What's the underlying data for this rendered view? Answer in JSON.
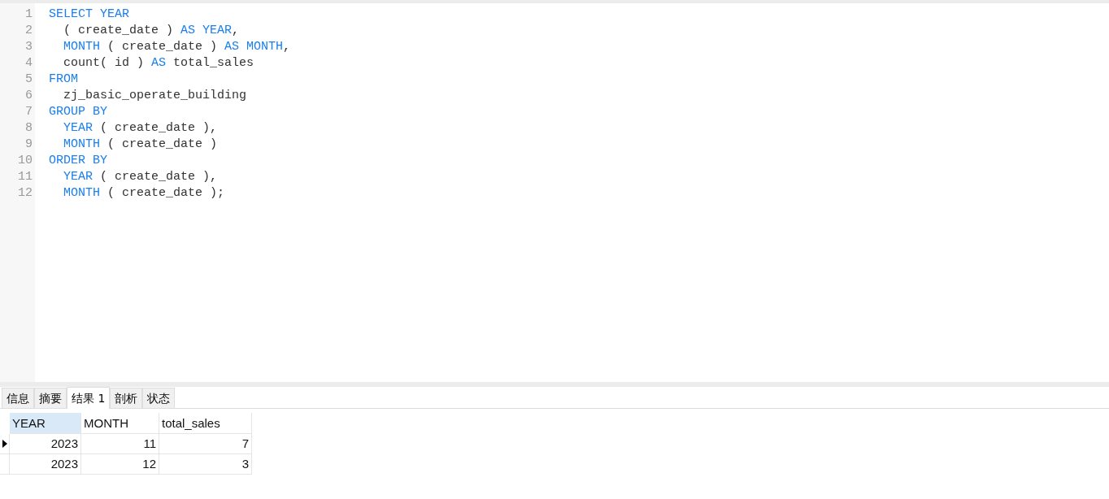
{
  "editor": {
    "lines": [
      {
        "number": "1",
        "tokens": [
          {
            "text": "SELECT YEAR",
            "kind": "keyword"
          }
        ]
      },
      {
        "number": "2",
        "tokens": [
          {
            "text": "  ( create_date ) ",
            "kind": "plain"
          },
          {
            "text": "AS YEAR",
            "kind": "keyword"
          },
          {
            "text": ",",
            "kind": "plain"
          }
        ]
      },
      {
        "number": "3",
        "tokens": [
          {
            "text": "  MONTH",
            "kind": "keyword"
          },
          {
            "text": " ( create_date ) ",
            "kind": "plain"
          },
          {
            "text": "AS MONTH",
            "kind": "keyword"
          },
          {
            "text": ",",
            "kind": "plain"
          }
        ]
      },
      {
        "number": "4",
        "tokens": [
          {
            "text": "  count( id ) ",
            "kind": "plain"
          },
          {
            "text": "AS",
            "kind": "keyword"
          },
          {
            "text": " total_sales",
            "kind": "plain"
          }
        ]
      },
      {
        "number": "5",
        "tokens": [
          {
            "text": "FROM",
            "kind": "keyword"
          }
        ]
      },
      {
        "number": "6",
        "tokens": [
          {
            "text": "  zj_basic_operate_building",
            "kind": "plain"
          }
        ]
      },
      {
        "number": "7",
        "tokens": [
          {
            "text": "GROUP BY",
            "kind": "keyword"
          }
        ]
      },
      {
        "number": "8",
        "tokens": [
          {
            "text": "  YEAR",
            "kind": "keyword"
          },
          {
            "text": " ( create_date ),",
            "kind": "plain"
          }
        ]
      },
      {
        "number": "9",
        "tokens": [
          {
            "text": "  MONTH",
            "kind": "keyword"
          },
          {
            "text": " ( create_date )",
            "kind": "plain"
          }
        ]
      },
      {
        "number": "10",
        "tokens": [
          {
            "text": "ORDER BY",
            "kind": "keyword"
          }
        ]
      },
      {
        "number": "11",
        "tokens": [
          {
            "text": "  YEAR",
            "kind": "keyword"
          },
          {
            "text": " ( create_date ),",
            "kind": "plain"
          }
        ]
      },
      {
        "number": "12",
        "tokens": [
          {
            "text": "  MONTH",
            "kind": "keyword"
          },
          {
            "text": " ( create_date );",
            "kind": "plain"
          }
        ]
      }
    ]
  },
  "tabs": [
    {
      "label": "信息",
      "selected": false
    },
    {
      "label": "摘要",
      "selected": false
    },
    {
      "label": "结果 1",
      "selected": true
    },
    {
      "label": "剖析",
      "selected": false
    },
    {
      "label": "状态",
      "selected": false
    }
  ],
  "table": {
    "columns": [
      {
        "label": "YEAR",
        "selected": true
      },
      {
        "label": "MONTH",
        "selected": false
      },
      {
        "label": "total_sales",
        "selected": false
      }
    ],
    "rows": [
      {
        "current": true,
        "cells": [
          "2023",
          "11",
          "7"
        ]
      },
      {
        "current": false,
        "cells": [
          "2023",
          "12",
          "3"
        ]
      }
    ]
  }
}
